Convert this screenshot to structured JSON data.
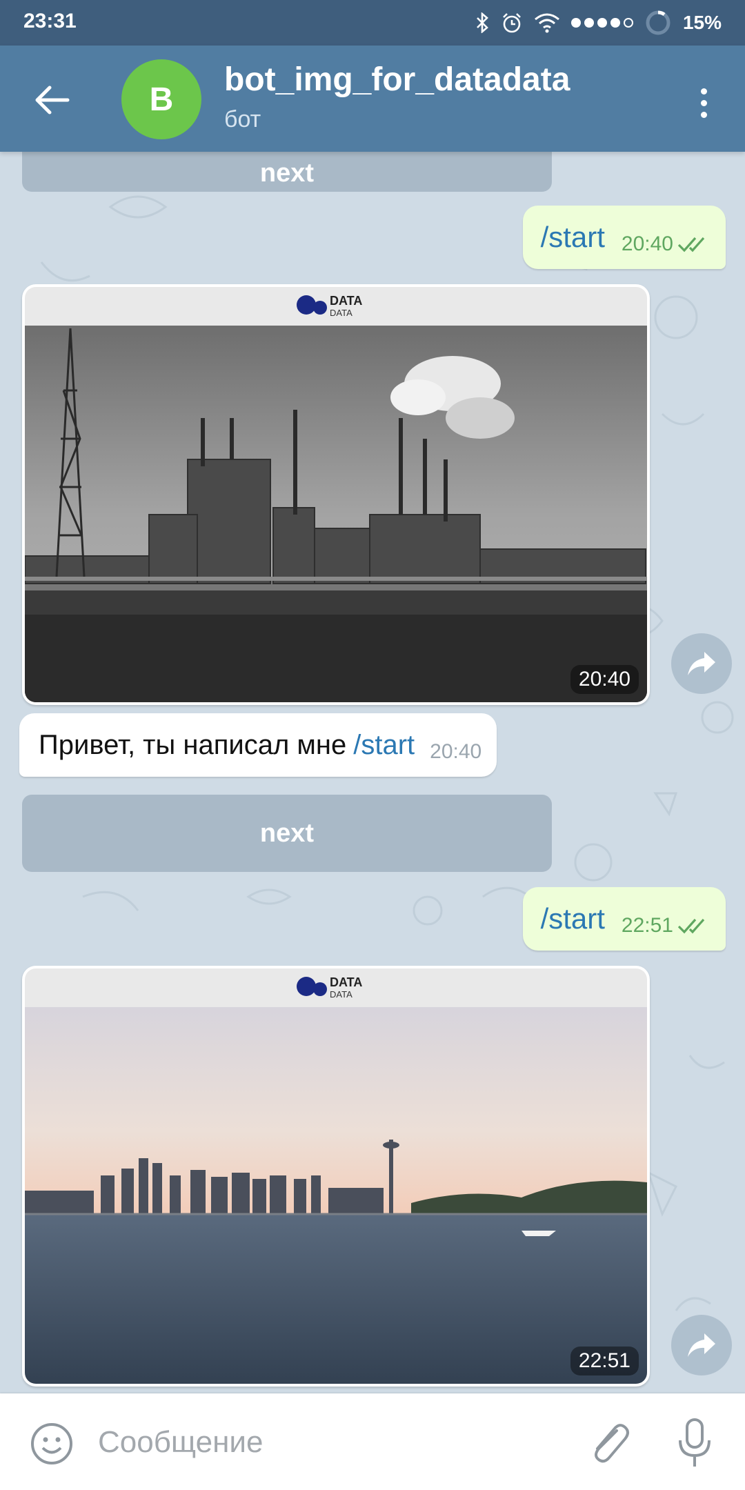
{
  "status_bar": {
    "time": "23:31",
    "battery": "15%",
    "icons": [
      "bluetooth-icon",
      "alarm-icon",
      "wifi-icon",
      "signal-icon",
      "battery-icon"
    ]
  },
  "header": {
    "avatar_letter": "B",
    "title": "bot_img_for_datadata",
    "subtitle": "бот"
  },
  "photo_logo": {
    "line1": "DATA",
    "line2": "DATA"
  },
  "messages": {
    "top_button_label": "next",
    "out1": {
      "text": "/start",
      "time": "20:40"
    },
    "photo1": {
      "time": "20:40",
      "subject": "industrial plant"
    },
    "in1": {
      "text": "Привет, ты написал мне",
      "command": "/start",
      "time": "20:40"
    },
    "button_label": "next",
    "out2": {
      "text": "/start",
      "time": "22:51"
    },
    "photo2": {
      "time": "22:51",
      "subject": "city skyline over water"
    }
  },
  "input_bar": {
    "placeholder": "Сообщение"
  },
  "colors": {
    "header": "#517da2",
    "status_bar": "#3f5e7d",
    "avatar": "#6cc64b",
    "outgoing_bubble": "#eefed9",
    "link": "#2b78b3",
    "check": "#5fa760"
  }
}
